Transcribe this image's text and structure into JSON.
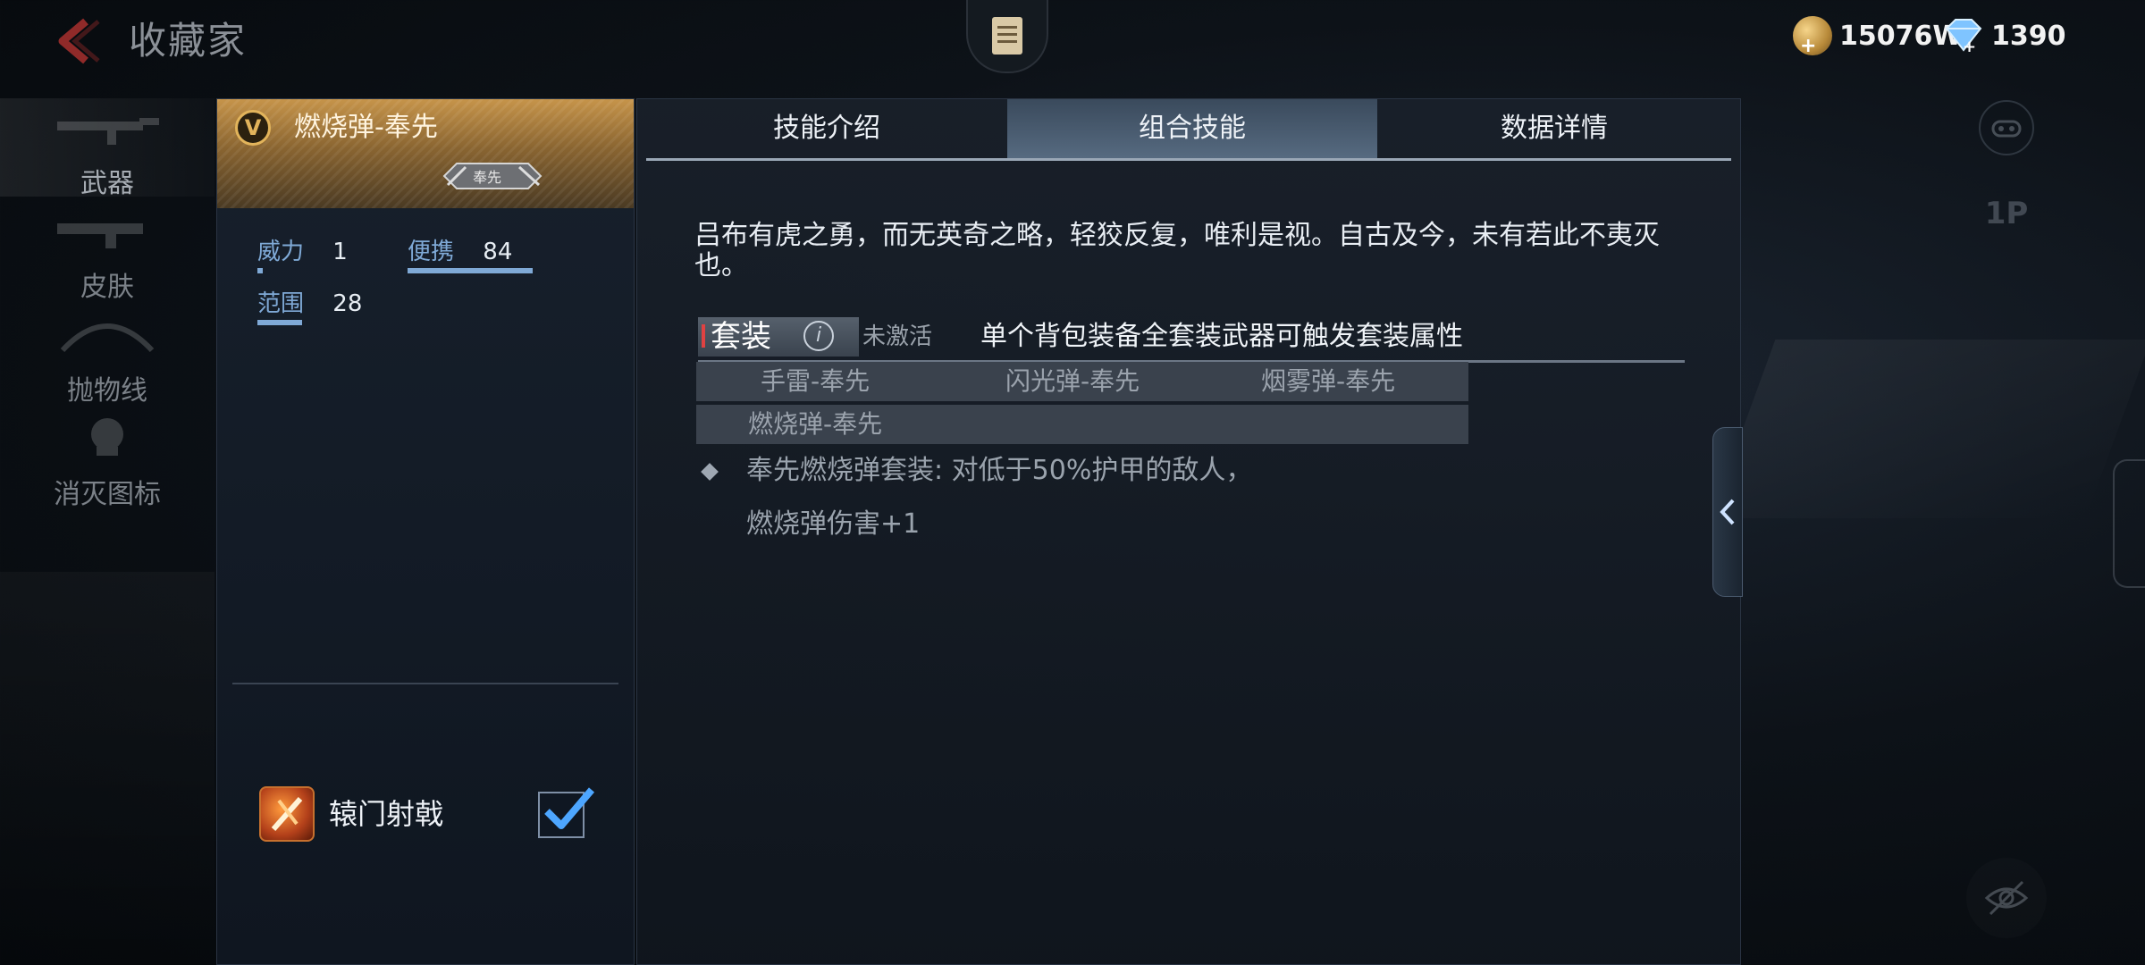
{
  "header": {
    "title": "收藏家",
    "coins": "15076W",
    "gems": "1390"
  },
  "left_nav": {
    "items": [
      {
        "label": "武器"
      },
      {
        "label": "皮肤"
      },
      {
        "label": "抛物线"
      },
      {
        "label": "消灭图标"
      }
    ]
  },
  "item_panel": {
    "badge": "V",
    "name": "燃烧弹-奉先",
    "emblem_text": "奉先",
    "stats": {
      "power_label": "威力",
      "power_value": "1",
      "carry_label": "便携",
      "carry_value": "84",
      "range_label": "范围",
      "range_value": "28"
    },
    "skill": {
      "name": "辕门射戟",
      "enabled": true
    }
  },
  "tabs": [
    {
      "label": "技能介绍"
    },
    {
      "label": "组合技能"
    },
    {
      "label": "数据详情"
    }
  ],
  "combo": {
    "description": "吕布有虎之勇，而无英奇之略，轻狡反复，唯利是视。自古及今，未有若此不夷灭也。",
    "set_label": "套装",
    "set_status": "未激活",
    "set_rule": "单个背包装备全套装武器可触发套装属性",
    "set_items": [
      "手雷-奉先",
      "闪光弹-奉先",
      "烟雾弹-奉先",
      "燃烧弹-奉先"
    ],
    "effect_line1": "奉先燃烧弹套装: 对低于50%护甲的敌人，",
    "effect_line2": "燃烧弹伤害+1"
  },
  "right_controls": {
    "ghost_label": "1P"
  },
  "colors": {
    "accent_gold": "#c6944a",
    "stat_blue": "#7fa9d6",
    "tab_active": "#566a80"
  }
}
